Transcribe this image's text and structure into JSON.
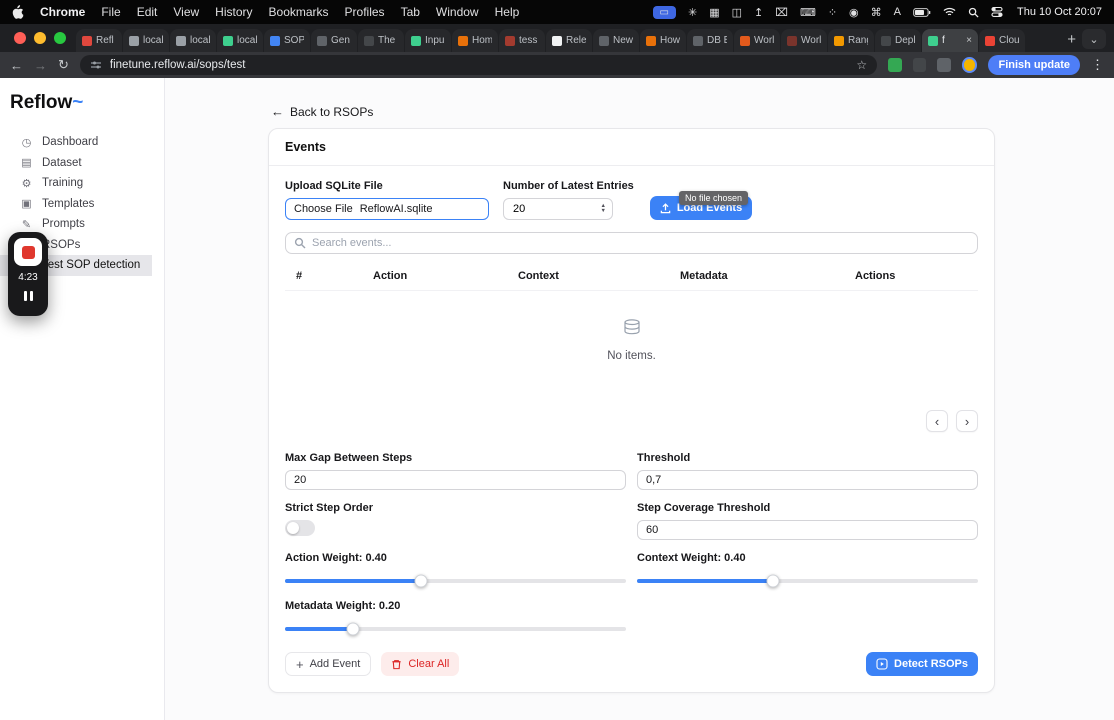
{
  "glyphs": {
    "back_arrow": "←",
    "forward_arrow": "→",
    "reload": "↻",
    "star": "☆",
    "menu_dots": "⋮",
    "new_tab": "+",
    "tab_chevron": "⌄",
    "close": "×",
    "caret_up": "▲",
    "caret_down": "▼",
    "prev": "‹",
    "next": "›",
    "plus": "+"
  },
  "menubar": {
    "app_name": "Chrome",
    "items": [
      "File",
      "Edit",
      "View",
      "History",
      "Bookmarks",
      "Profiles",
      "Tab",
      "Window",
      "Help"
    ],
    "status_icons": [
      {
        "name": "screen-mirroring-indicator",
        "glyph": "▭",
        "pill": true
      },
      {
        "name": "gear-icon",
        "glyph": "✳"
      },
      {
        "name": "window-grid-icon",
        "glyph": "▦"
      },
      {
        "name": "camera-icon",
        "glyph": "◫"
      },
      {
        "name": "airplay-icon",
        "glyph": "↥"
      },
      {
        "name": "close-box-icon",
        "glyph": "⌧"
      },
      {
        "name": "keyboard-icon",
        "glyph": "⌨"
      },
      {
        "name": "paw-icon",
        "glyph": "⁘"
      },
      {
        "name": "record-icon",
        "glyph": "◉"
      },
      {
        "name": "command-icon",
        "glyph": "⌘"
      },
      {
        "name": "input-source-icon",
        "glyph": "A"
      }
    ],
    "clock": "Thu 10 Oct 20:07"
  },
  "tabstrip": {
    "tabs": [
      {
        "label": "Refl",
        "color": "#e0483e"
      },
      {
        "label": "local",
        "color": "#9aa0a6"
      },
      {
        "label": "local",
        "color": "#9aa0a6"
      },
      {
        "label": "local",
        "color": "#3ecf8e"
      },
      {
        "label": "SOP",
        "color": "#4285f4"
      },
      {
        "label": "Gen",
        "color": "#5f6368"
      },
      {
        "label": "The",
        "color": "#44474a"
      },
      {
        "label": "Inpu",
        "color": "#3ecf8e"
      },
      {
        "label": "Hom",
        "color": "#e8710a"
      },
      {
        "label": "tess",
        "color": "#a33b2f"
      },
      {
        "label": "Rele",
        "color": "#f1f3f4"
      },
      {
        "label": "New",
        "color": "#5f6368"
      },
      {
        "label": "How",
        "color": "#e8710a"
      },
      {
        "label": "DB B",
        "color": "#5f6368"
      },
      {
        "label": "Worl",
        "color": "#e25a1c"
      },
      {
        "label": "Worl",
        "color": "#7a342c"
      },
      {
        "label": "Rang",
        "color": "#f29900"
      },
      {
        "label": "Depl",
        "color": "#44474a"
      },
      {
        "label": "f",
        "color": "#3ecf8e",
        "active": true
      },
      {
        "label": "Clou",
        "color": "#ea4335"
      }
    ]
  },
  "toolbar": {
    "url": "finetune.reflow.ai/sops/test",
    "update_button": "Finish update"
  },
  "sidebar": {
    "logo_text": "Reflow",
    "logo_accent": "~",
    "items": [
      {
        "label": "Dashboard",
        "icon": "dashboard-icon",
        "glyph": "◷"
      },
      {
        "label": "Dataset",
        "icon": "dataset-icon",
        "glyph": "▤"
      },
      {
        "label": "Training",
        "icon": "training-icon",
        "glyph": "⚙"
      },
      {
        "label": "Templates",
        "icon": "templates-icon",
        "glyph": "▣"
      },
      {
        "label": "Prompts",
        "icon": "prompts-icon",
        "glyph": "✎"
      },
      {
        "label": "RSOPs",
        "icon": "rsops-icon",
        "glyph": "▦"
      },
      {
        "label": "Test SOP detection",
        "icon": "sop-detection-icon",
        "glyph": "▧",
        "active": true
      }
    ]
  },
  "recorder": {
    "time": "4:23"
  },
  "main": {
    "back_link": "Back to RSOPs",
    "events": {
      "title": "Events",
      "upload_label": "Upload SQLite File",
      "choose_file": "Choose File",
      "file_name": "ReflowAI.sqlite",
      "entries_label": "Number of Latest Entries",
      "entries_value": "20",
      "load_button": "Load Events",
      "tooltip": "No file chosen",
      "search_placeholder": "Search events...",
      "columns": [
        "#",
        "Action",
        "Context",
        "Metadata",
        "Actions"
      ],
      "empty_text": "No items."
    },
    "settings": {
      "max_gap_label": "Max Gap Between Steps",
      "max_gap_value": "20",
      "threshold_label": "Threshold",
      "threshold_value": "0,7",
      "strict_label": "Strict Step Order",
      "coverage_label": "Step Coverage Threshold",
      "coverage_value": "60",
      "sliders": [
        {
          "label": "Action Weight: 0.40",
          "value": 0.4
        },
        {
          "label": "Context Weight: 0.40",
          "value": 0.4
        },
        {
          "label": "Metadata Weight: 0.20",
          "value": 0.2
        }
      ]
    },
    "footer": {
      "add_event": "Add Event",
      "clear_all": "Clear All",
      "detect": "Detect RSOPs"
    }
  }
}
